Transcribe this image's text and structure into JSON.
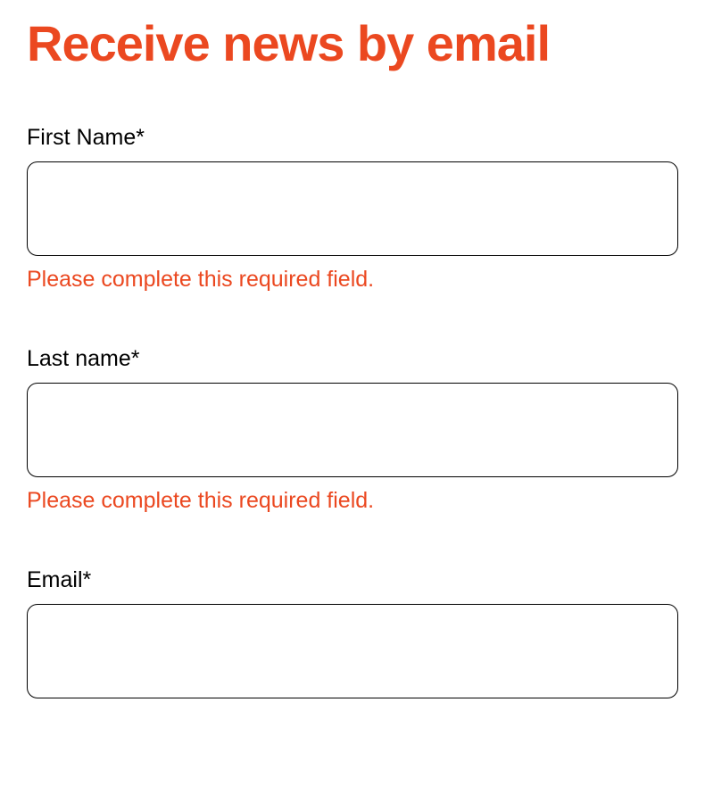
{
  "title": "Receive news by email",
  "fields": {
    "first_name": {
      "label": "First Name*",
      "value": "",
      "error": "Please complete this required field."
    },
    "last_name": {
      "label": "Last name*",
      "value": "",
      "error": "Please complete this required field."
    },
    "email": {
      "label": "Email*",
      "value": ""
    }
  }
}
